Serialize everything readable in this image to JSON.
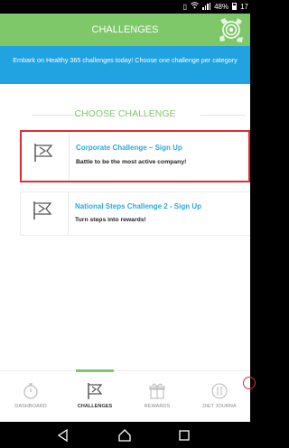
{
  "status_bar": {
    "battery_text": "48%",
    "time_text": "17"
  },
  "header": {
    "title": "CHALLENGES"
  },
  "intro": {
    "text": "Embark on Healthy 365 challenges today! Choose one challenge per category"
  },
  "section": {
    "title": "CHOOSE CHALLENGE"
  },
  "challenges": [
    {
      "name": "Corporate Challenge – Sign Up",
      "description": "Battle to be the most active company!",
      "icon": "flag-icon",
      "selected": true
    },
    {
      "name": "National Steps Challenge 2 - Sign Up",
      "description": "Turn steps into rewards!",
      "icon": "flag-icon",
      "selected": false
    }
  ],
  "bottom_nav": {
    "active": "CHALLENGES",
    "tabs": [
      {
        "label": "DASHBOARD",
        "icon": "stopwatch-icon"
      },
      {
        "label": "CHALLENGES",
        "icon": "flag-icon"
      },
      {
        "label": "REWARDS",
        "icon": "gift-icon"
      },
      {
        "label": "DIET JOURNA",
        "icon": "diet-icon"
      }
    ]
  },
  "colors": {
    "green": "#7ec86a",
    "blue": "#21a3e2",
    "link_blue": "#2aa9de",
    "selected_border": "#e02a30"
  }
}
